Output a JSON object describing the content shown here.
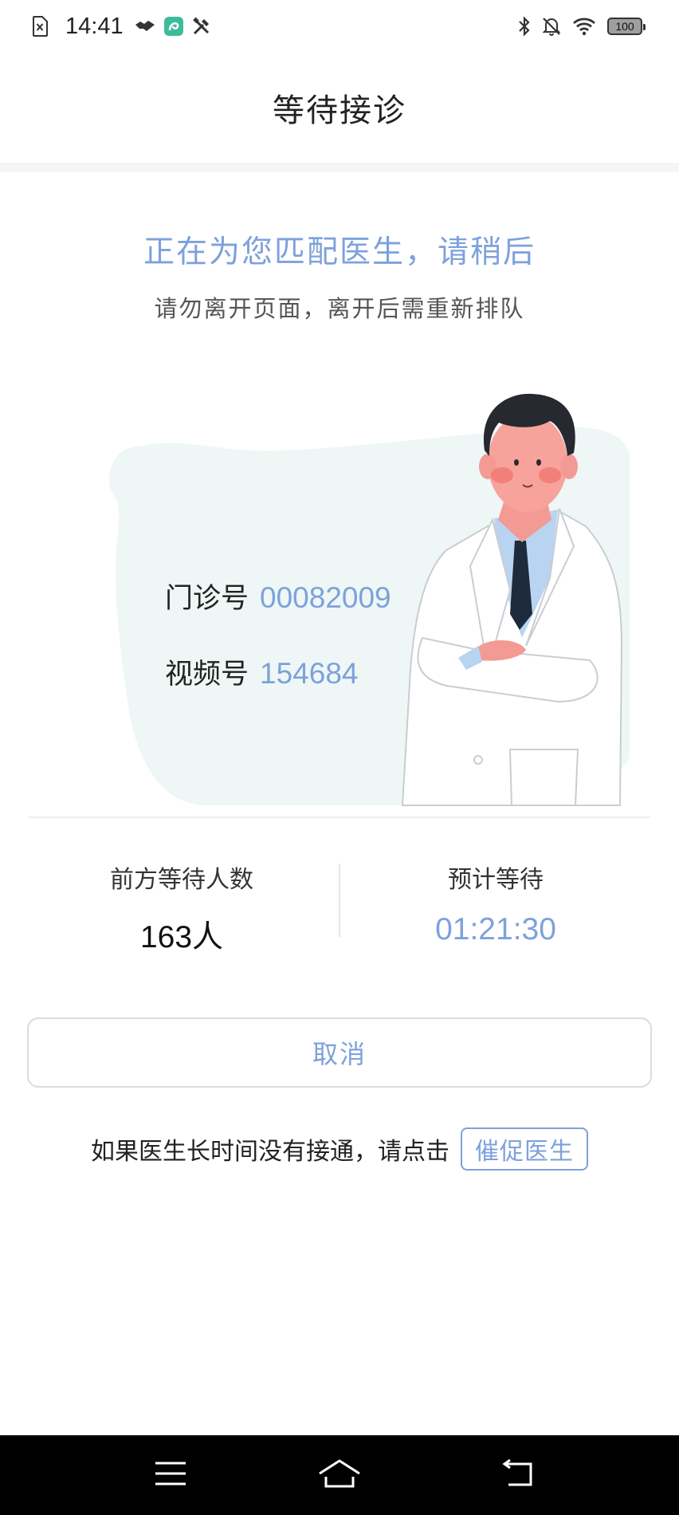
{
  "status_bar": {
    "time": "14:41",
    "battery": "100",
    "left_icons": [
      "sim-card-icon",
      "handshake-icon",
      "app-icon",
      "tools-icon"
    ],
    "right_icons": [
      "bluetooth-icon",
      "silent-bell-icon",
      "wifi-icon",
      "battery-icon"
    ]
  },
  "header": {
    "title": "等待接诊"
  },
  "main": {
    "headline": "正在为您匹配医生，请稍后",
    "subline": "请勿离开页面，离开后需重新排队",
    "clinic_number": {
      "label": "门诊号",
      "value": "00082009"
    },
    "video_number": {
      "label": "视频号",
      "value": "154684"
    },
    "illustration": "doctor-illustration"
  },
  "stats": {
    "queue": {
      "label": "前方等待人数",
      "value": "163人"
    },
    "wait": {
      "label": "预计等待",
      "value": "01:21:30"
    }
  },
  "actions": {
    "cancel_label": "取消",
    "urge_prompt": "如果医生长时间没有接通，请点击",
    "urge_label": "催促医生"
  },
  "nav_bar": {
    "icons": [
      "menu-icon",
      "home-icon",
      "back-icon"
    ]
  },
  "colors": {
    "accent": "#7da1dc",
    "blob": "#eef7f5",
    "nav_background": "#000000"
  }
}
